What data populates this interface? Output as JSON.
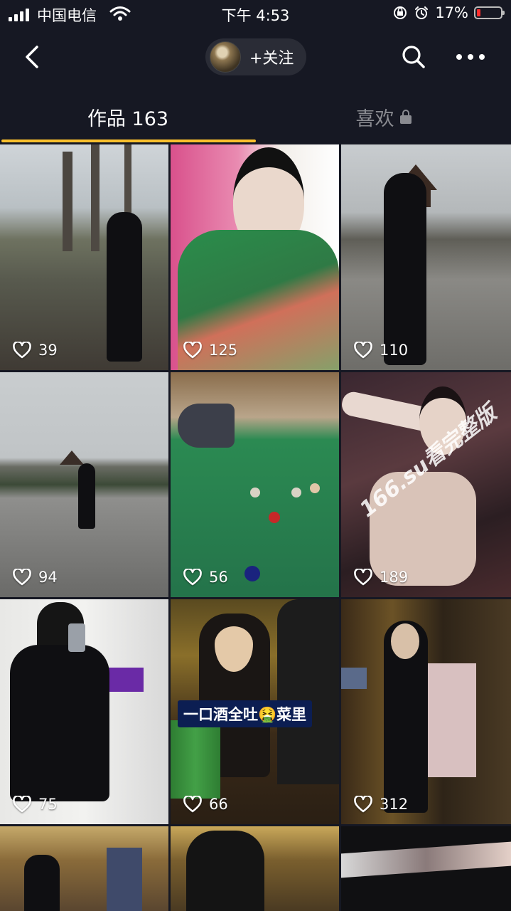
{
  "status_bar": {
    "carrier": "中国电信",
    "time": "下午 4:53",
    "battery": "17%"
  },
  "nav": {
    "follow_label": "+关注"
  },
  "tabs": [
    {
      "label": "作品 163",
      "active": true
    },
    {
      "label": "喜欢",
      "active": false,
      "locked": true
    }
  ],
  "accent_color": "#fbc02d",
  "videos": [
    {
      "likes": "39"
    },
    {
      "likes": "125"
    },
    {
      "likes": "110"
    },
    {
      "likes": "94"
    },
    {
      "likes": "56"
    },
    {
      "likes": "189"
    },
    {
      "likes": "75"
    },
    {
      "likes": "66",
      "caption": "一口酒全吐🤮菜里"
    },
    {
      "likes": "312"
    }
  ],
  "watermark": "166.su看完整版"
}
